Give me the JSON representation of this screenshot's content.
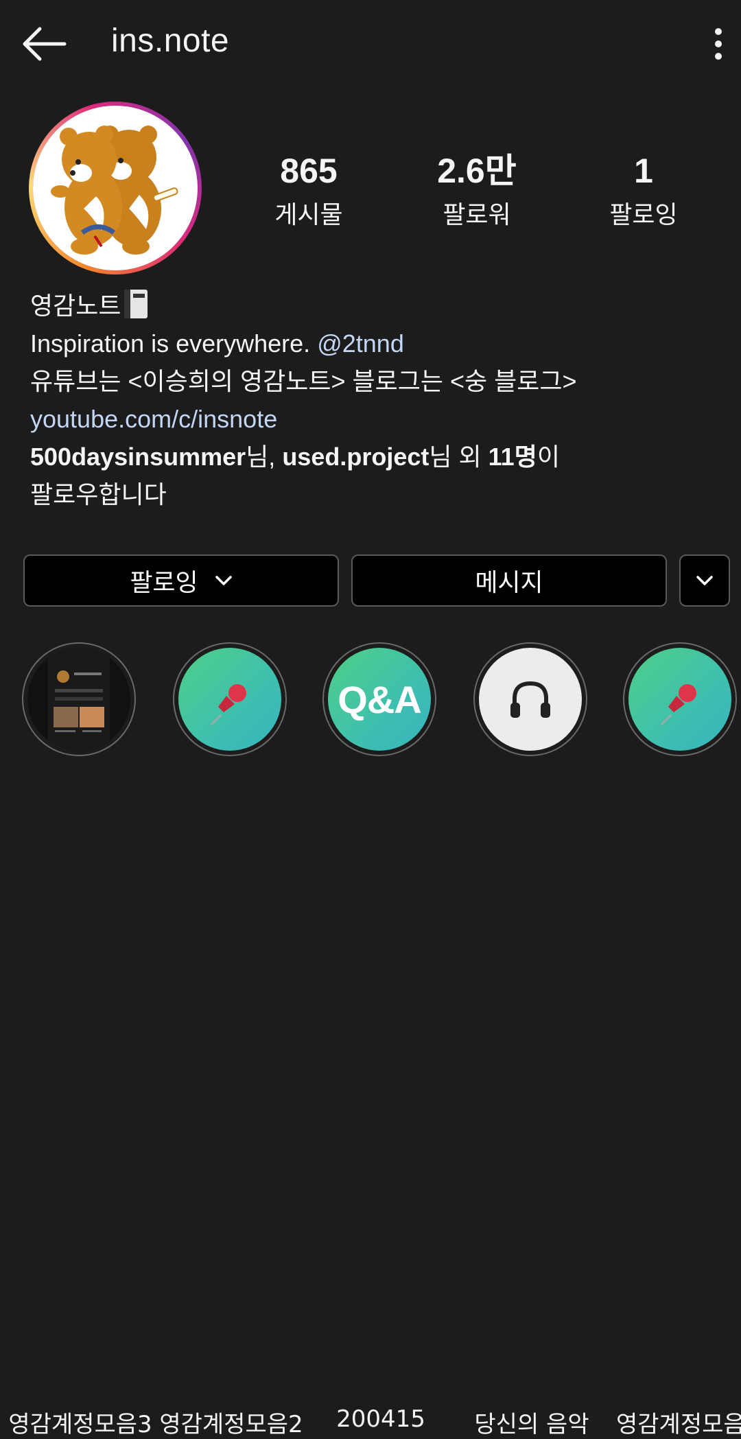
{
  "header": {
    "title": "ins.note"
  },
  "stats": [
    {
      "value": "865",
      "label": "게시물"
    },
    {
      "value": "2.6만",
      "label": "팔로워"
    },
    {
      "value": "1",
      "label": "팔로잉"
    }
  ],
  "bio": {
    "name": "영감노트",
    "line1_text": "Inspiration is everywhere.",
    "line1_mention": "@2tnnd",
    "line2": "유튜브는 <이승희의 영감노트> 블로그는 <숭 블로그>",
    "link": "youtube.com/c/insnote",
    "followed_by": {
      "user1": "500daysinsummer",
      "sep1": "님, ",
      "user2": "used.project",
      "sep2": "님 외 ",
      "count": "11명",
      "suffix": "이",
      "line2": "팔로우합니다"
    }
  },
  "buttons": {
    "following": "팔로잉",
    "message": "메시지"
  },
  "highlights": [
    {
      "label": "영감계정모음3",
      "cover": "screenshot"
    },
    {
      "label": "영감계정모음2",
      "cover": "pushpin-icon"
    },
    {
      "label": "200415",
      "cover_text": "Q&A"
    },
    {
      "label": "당신의 음악",
      "cover": "headphones-icon"
    },
    {
      "label": "영감계정모음",
      "cover": "pushpin-icon"
    }
  ],
  "colors": {
    "background": "#1c1c1c",
    "link": "#c3d7f4",
    "highlight_teal": "#4fcf86"
  }
}
